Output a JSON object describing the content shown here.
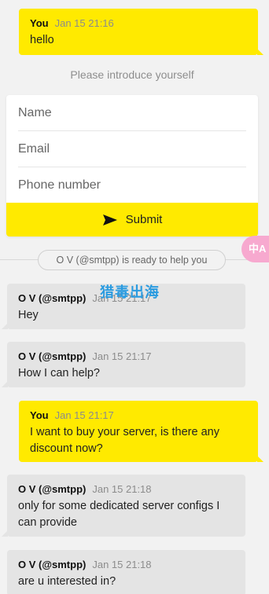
{
  "messages": [
    {
      "author": "You",
      "time": "Jan 15 21:16",
      "text": "hello",
      "from": "me"
    },
    {
      "author": "O V (@smtpp)",
      "time": "Jan 15 21:17",
      "text": "Hey",
      "from": "them"
    },
    {
      "author": "O V (@smtpp)",
      "time": "Jan 15 21:17",
      "text": "How I can help?",
      "from": "them"
    },
    {
      "author": "You",
      "time": "Jan 15 21:17",
      "text": "I want to buy your server, is there any discount now?",
      "from": "me"
    },
    {
      "author": "O V (@smtpp)",
      "time": "Jan 15 21:18",
      "text": "only for some dedicated server configs I can provide",
      "from": "them"
    },
    {
      "author": "O V (@smtpp)",
      "time": "Jan 15 21:18",
      "text": "are u interested in?",
      "from": "them"
    }
  ],
  "intro_form": {
    "prompt": "Please introduce yourself",
    "name_placeholder": "Name",
    "email_placeholder": "Email",
    "phone_placeholder": "Phone number",
    "submit_label": "Submit"
  },
  "system_notice": "O V (@smtpp) is ready to help you",
  "translate_button": {
    "label": "中A",
    "icon": "translate-icon"
  },
  "watermark": "猎毒出海",
  "colors": {
    "accent": "#ffea00",
    "incoming_bubble": "#e4e4e4",
    "background": "#f2f2f2"
  }
}
